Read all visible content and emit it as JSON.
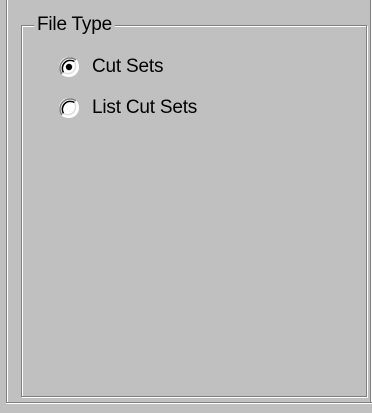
{
  "group": {
    "title": "File Type"
  },
  "options": [
    {
      "label": "Cut Sets",
      "selected": true
    },
    {
      "label": "List Cut Sets",
      "selected": false
    }
  ],
  "colors": {
    "face": "#c0c0c0",
    "shadow": "#808080",
    "highlight": "#ffffff",
    "dark": "#000000"
  },
  "icons": {
    "selected": "radio-selected-icon",
    "unselected": "radio-unselected-icon"
  }
}
